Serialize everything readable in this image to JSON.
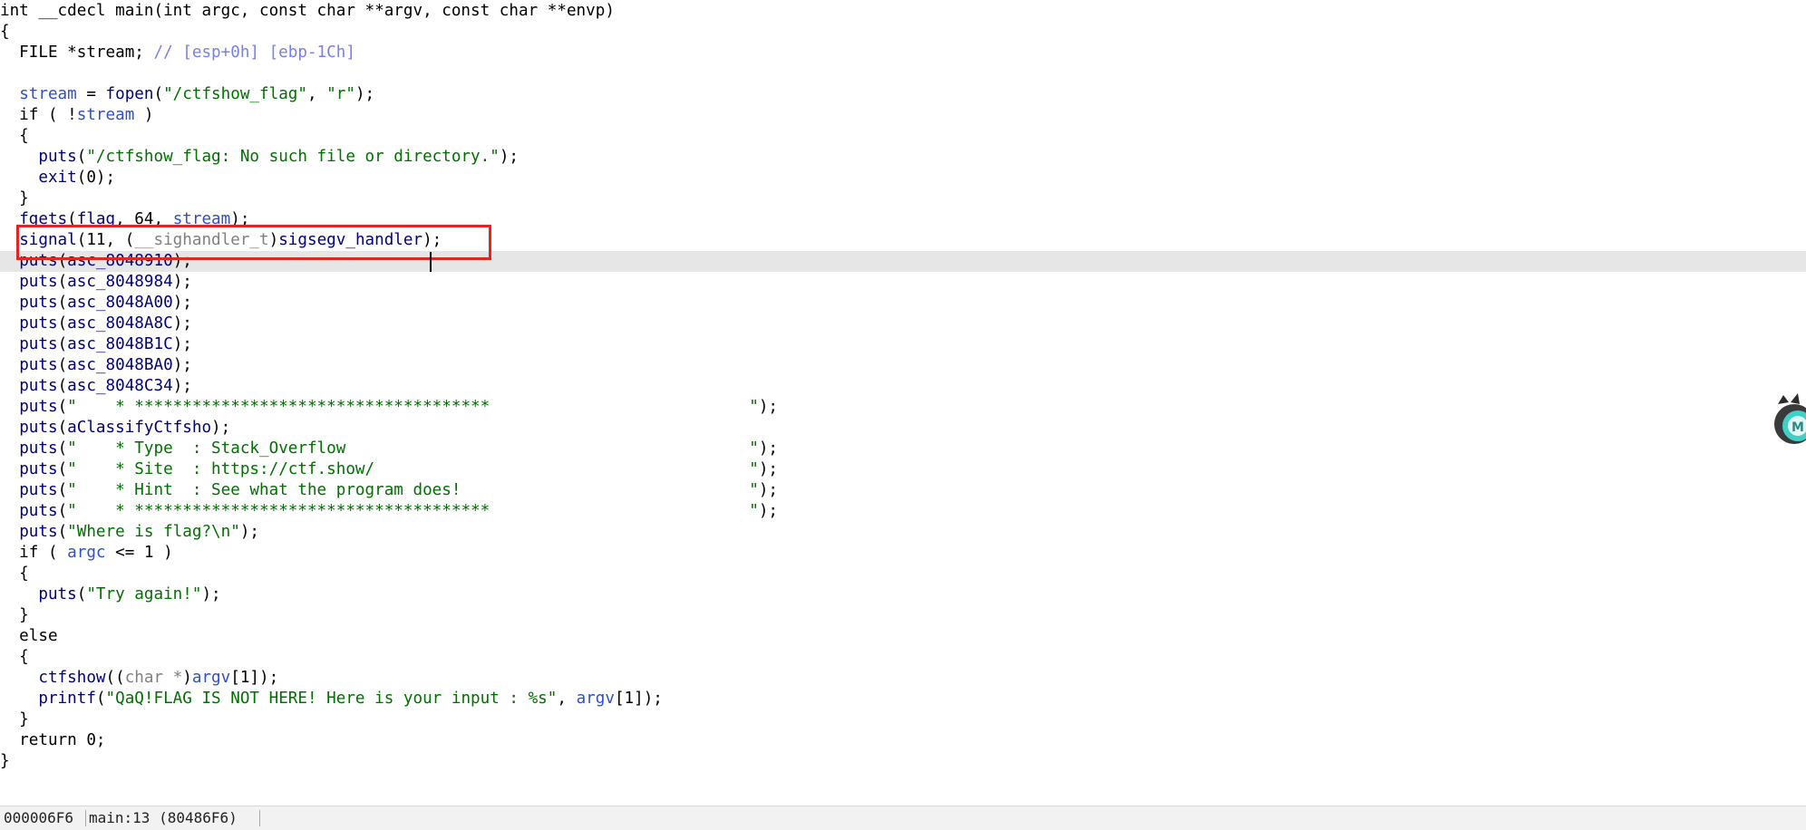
{
  "code_lines": [
    [
      {
        "t": "int __cdecl main(int argc, const char **argv, const char **envp)",
        "c": "plain"
      }
    ],
    [
      {
        "t": "{",
        "c": "plain"
      }
    ],
    [
      {
        "t": "  FILE *stream; ",
        "c": "plain"
      },
      {
        "t": "// [esp+0h] [ebp-1Ch]",
        "c": "cmt"
      }
    ],
    [],
    [
      {
        "t": "  ",
        "c": "plain"
      },
      {
        "t": "stream",
        "c": "var"
      },
      {
        "t": " = ",
        "c": "plain"
      },
      {
        "t": "fopen",
        "c": "fn"
      },
      {
        "t": "(",
        "c": "plain"
      },
      {
        "t": "\"/ctfshow_flag\"",
        "c": "str"
      },
      {
        "t": ", ",
        "c": "plain"
      },
      {
        "t": "\"r\"",
        "c": "str"
      },
      {
        "t": ");",
        "c": "plain"
      }
    ],
    [
      {
        "t": "  if ( !",
        "c": "plain"
      },
      {
        "t": "stream",
        "c": "var"
      },
      {
        "t": " )",
        "c": "plain"
      }
    ],
    [
      {
        "t": "  {",
        "c": "plain"
      }
    ],
    [
      {
        "t": "    ",
        "c": "plain"
      },
      {
        "t": "puts",
        "c": "fn"
      },
      {
        "t": "(",
        "c": "plain"
      },
      {
        "t": "\"/ctfshow_flag: No such file or directory.\"",
        "c": "str"
      },
      {
        "t": ");",
        "c": "plain"
      }
    ],
    [
      {
        "t": "    ",
        "c": "plain"
      },
      {
        "t": "exit",
        "c": "fn"
      },
      {
        "t": "(0);",
        "c": "plain"
      }
    ],
    [
      {
        "t": "  }",
        "c": "plain"
      }
    ],
    [
      {
        "t": "  ",
        "c": "plain"
      },
      {
        "t": "fgets",
        "c": "fn"
      },
      {
        "t": "(",
        "c": "plain"
      },
      {
        "t": "flag",
        "c": "fn"
      },
      {
        "t": ", 64, ",
        "c": "plain"
      },
      {
        "t": "stream",
        "c": "var"
      },
      {
        "t": ");",
        "c": "plain"
      }
    ],
    [
      {
        "t": "  ",
        "c": "plain"
      },
      {
        "t": "signal",
        "c": "fn"
      },
      {
        "t": "(11, (",
        "c": "plain"
      },
      {
        "t": "__sighandler_t",
        "c": "cast"
      },
      {
        "t": ")",
        "c": "plain"
      },
      {
        "t": "sigsegv_handler",
        "c": "fn"
      },
      {
        "t": ");",
        "c": "plain"
      }
    ],
    [
      {
        "t": "  ",
        "c": "plain"
      },
      {
        "t": "puts",
        "c": "fn"
      },
      {
        "t": "(",
        "c": "plain"
      },
      {
        "t": "asc_8048910",
        "c": "fn"
      },
      {
        "t": ");",
        "c": "plain"
      }
    ],
    [
      {
        "t": "  ",
        "c": "plain"
      },
      {
        "t": "puts",
        "c": "fn"
      },
      {
        "t": "(",
        "c": "plain"
      },
      {
        "t": "asc_8048984",
        "c": "fn"
      },
      {
        "t": ");",
        "c": "plain"
      }
    ],
    [
      {
        "t": "  ",
        "c": "plain"
      },
      {
        "t": "puts",
        "c": "fn"
      },
      {
        "t": "(",
        "c": "plain"
      },
      {
        "t": "asc_8048A00",
        "c": "fn"
      },
      {
        "t": ");",
        "c": "plain"
      }
    ],
    [
      {
        "t": "  ",
        "c": "plain"
      },
      {
        "t": "puts",
        "c": "fn"
      },
      {
        "t": "(",
        "c": "plain"
      },
      {
        "t": "asc_8048A8C",
        "c": "fn"
      },
      {
        "t": ");",
        "c": "plain"
      }
    ],
    [
      {
        "t": "  ",
        "c": "plain"
      },
      {
        "t": "puts",
        "c": "fn"
      },
      {
        "t": "(",
        "c": "plain"
      },
      {
        "t": "asc_8048B1C",
        "c": "fn"
      },
      {
        "t": ");",
        "c": "plain"
      }
    ],
    [
      {
        "t": "  ",
        "c": "plain"
      },
      {
        "t": "puts",
        "c": "fn"
      },
      {
        "t": "(",
        "c": "plain"
      },
      {
        "t": "asc_8048BA0",
        "c": "fn"
      },
      {
        "t": ");",
        "c": "plain"
      }
    ],
    [
      {
        "t": "  ",
        "c": "plain"
      },
      {
        "t": "puts",
        "c": "fn"
      },
      {
        "t": "(",
        "c": "plain"
      },
      {
        "t": "asc_8048C34",
        "c": "fn"
      },
      {
        "t": ");",
        "c": "plain"
      }
    ],
    [
      {
        "t": "  ",
        "c": "plain"
      },
      {
        "t": "puts",
        "c": "fn"
      },
      {
        "t": "(",
        "c": "plain"
      },
      {
        "t": "\"    * *************************************                           \"",
        "c": "str"
      },
      {
        "t": ");",
        "c": "plain"
      }
    ],
    [
      {
        "t": "  ",
        "c": "plain"
      },
      {
        "t": "puts",
        "c": "fn"
      },
      {
        "t": "(",
        "c": "plain"
      },
      {
        "t": "aClassifyCtfsho",
        "c": "fn"
      },
      {
        "t": ");",
        "c": "plain"
      }
    ],
    [
      {
        "t": "  ",
        "c": "plain"
      },
      {
        "t": "puts",
        "c": "fn"
      },
      {
        "t": "(",
        "c": "plain"
      },
      {
        "t": "\"    * Type  : Stack_Overflow                                          \"",
        "c": "str"
      },
      {
        "t": ");",
        "c": "plain"
      }
    ],
    [
      {
        "t": "  ",
        "c": "plain"
      },
      {
        "t": "puts",
        "c": "fn"
      },
      {
        "t": "(",
        "c": "plain"
      },
      {
        "t": "\"    * Site  : https://ctf.show/                                       \"",
        "c": "str"
      },
      {
        "t": ");",
        "c": "plain"
      }
    ],
    [
      {
        "t": "  ",
        "c": "plain"
      },
      {
        "t": "puts",
        "c": "fn"
      },
      {
        "t": "(",
        "c": "plain"
      },
      {
        "t": "\"    * Hint  : See what the program does!                              \"",
        "c": "str"
      },
      {
        "t": ");",
        "c": "plain"
      }
    ],
    [
      {
        "t": "  ",
        "c": "plain"
      },
      {
        "t": "puts",
        "c": "fn"
      },
      {
        "t": "(",
        "c": "plain"
      },
      {
        "t": "\"    * *************************************                           \"",
        "c": "str"
      },
      {
        "t": ");",
        "c": "plain"
      }
    ],
    [
      {
        "t": "  ",
        "c": "plain"
      },
      {
        "t": "puts",
        "c": "fn"
      },
      {
        "t": "(",
        "c": "plain"
      },
      {
        "t": "\"Where is flag?\\n\"",
        "c": "str"
      },
      {
        "t": ");",
        "c": "plain"
      }
    ],
    [
      {
        "t": "  if ( ",
        "c": "plain"
      },
      {
        "t": "argc",
        "c": "var"
      },
      {
        "t": " <= 1 )",
        "c": "plain"
      }
    ],
    [
      {
        "t": "  {",
        "c": "plain"
      }
    ],
    [
      {
        "t": "    ",
        "c": "plain"
      },
      {
        "t": "puts",
        "c": "fn"
      },
      {
        "t": "(",
        "c": "plain"
      },
      {
        "t": "\"Try again!\"",
        "c": "str"
      },
      {
        "t": ");",
        "c": "plain"
      }
    ],
    [
      {
        "t": "  }",
        "c": "plain"
      }
    ],
    [
      {
        "t": "  else",
        "c": "plain"
      }
    ],
    [
      {
        "t": "  {",
        "c": "plain"
      }
    ],
    [
      {
        "t": "    ",
        "c": "plain"
      },
      {
        "t": "ctfshow",
        "c": "fn"
      },
      {
        "t": "((",
        "c": "plain"
      },
      {
        "t": "char *",
        "c": "cast"
      },
      {
        "t": ")",
        "c": "plain"
      },
      {
        "t": "argv",
        "c": "var"
      },
      {
        "t": "[1]);",
        "c": "plain"
      }
    ],
    [
      {
        "t": "    ",
        "c": "plain"
      },
      {
        "t": "printf",
        "c": "fn"
      },
      {
        "t": "(",
        "c": "plain"
      },
      {
        "t": "\"QaQ!FLAG IS NOT HERE! Here is your input : %s\"",
        "c": "str"
      },
      {
        "t": ", ",
        "c": "plain"
      },
      {
        "t": "argv",
        "c": "var"
      },
      {
        "t": "[1]);",
        "c": "plain"
      }
    ],
    [
      {
        "t": "  }",
        "c": "plain"
      }
    ],
    [
      {
        "t": "  return 0;",
        "c": "plain"
      }
    ],
    [
      {
        "t": "}",
        "c": "plain"
      }
    ]
  ],
  "current_line_index": 12,
  "highlighted_line_index": 11,
  "colors": {
    "keyword": "#000000",
    "local_var": "#2f4fd0",
    "identifier": "#000080",
    "string": "#007000",
    "comment": "#7a7fe8",
    "cast": "#808080",
    "highlight_box": "#e52424",
    "current_line_bg": "#e6e6e6"
  },
  "status": {
    "address": "000006F6",
    "location": "main:13 (80486F6)"
  },
  "icons": {
    "overlay": "assistant-avatar-icon"
  }
}
